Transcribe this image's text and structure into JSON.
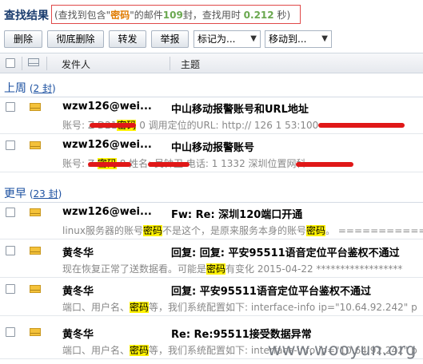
{
  "header": {
    "title": "查找结果",
    "search_prefix": "(查找到包含\"",
    "keyword": "密码",
    "search_mid": "\"的邮件",
    "count": "109",
    "search_mid2": "封，查找用时",
    "time": "0.212",
    "search_suffix": "秒)"
  },
  "toolbar": {
    "delete": "删除",
    "delete_permanent": "彻底删除",
    "forward": "转发",
    "report": "举报",
    "mark_as": "标记为...",
    "move_to": "移动到..."
  },
  "columns": {
    "sender": "发件人",
    "subject": "主题"
  },
  "groups": [
    {
      "name": "上周",
      "count_open": " (",
      "count": "2 封",
      "count_close": ")"
    },
    {
      "name": "更早",
      "count_open": " (",
      "count": "23 封",
      "count_close": ")"
    }
  ],
  "emails": [
    {
      "sender": "wzw126@wei...",
      "subject": "中山移动报警账号和URL地址",
      "preview_a": "账号:  Z   D21",
      "preview_kw": "密码",
      "preview_b": "   0    调用定位的URL:   http://           126   1     53:100"
    },
    {
      "sender": "wzw126@wei...",
      "subject": "中山移动报警账号",
      "preview_a": "账号:  Z          ",
      "preview_kw": "密码",
      "preview_b": "         8 姓名: 吴钟卫 电话:  1              1332 深圳位置网科"
    },
    {
      "sender": "wzw126@wei...",
      "subject": "Fw: Re: 深圳120端口开通",
      "preview_a": "linux服务器的账号",
      "preview_kw": "密码",
      "preview_b": "不是这个，是原来服务本身的账号",
      "preview_kw2": "密码",
      "preview_c": "。 ================"
    },
    {
      "sender": "黄冬华",
      "subject": "回复: 回复: 平安95511语音定位平台鉴权不通过",
      "preview_a": "现在恢复正常了送数据看。可能是",
      "preview_kw": "密码",
      "preview_b": "有变化 2015-04-22 ******************"
    },
    {
      "sender": "黄冬华",
      "subject": "回复: 平安95511语音定位平台鉴权不通过",
      "preview_a": "端口、用户名、",
      "preview_kw": "密码",
      "preview_b": "等，我们系统配置如下:  interface-info ip=\"10.64.92.242\" p"
    },
    {
      "sender": "黄冬华",
      "subject": "Re: Re:95511接受数据异常",
      "preview_a": "端口、用户名、",
      "preview_kw": "密码",
      "preview_b": "等，我们系统配置如下:  interface-info ip=\"10.64.92.242\" p"
    }
  ],
  "watermark": "www.wooyun.org",
  "colors": {
    "accent": "#1a4fa0",
    "highlight": "#fff200",
    "redaction": "#e01818",
    "search_border": "#e04848"
  }
}
